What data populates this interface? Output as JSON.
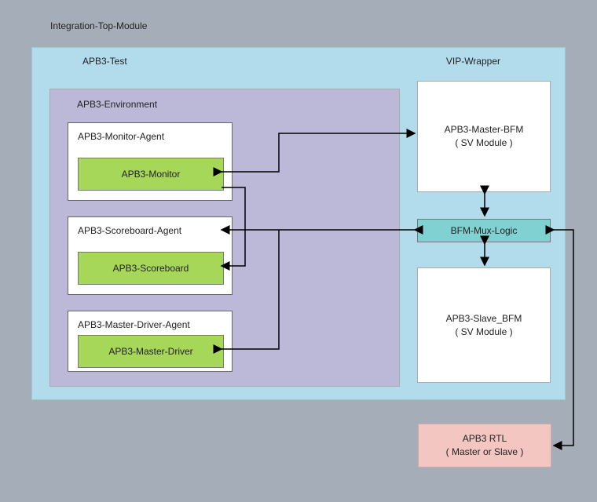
{
  "title": "Integration-Top-Module",
  "test": {
    "label": "APB3-Test",
    "env_label": "APB3-Environment",
    "agents": {
      "monitor": {
        "agent_label": "APB3-Monitor-Agent",
        "inner_label": "APB3-Monitor"
      },
      "scoreboard": {
        "agent_label": "APB3-Scoreboard-Agent",
        "inner_label": "APB3-Scoreboard"
      },
      "driver": {
        "agent_label": "APB3-Master-Driver-Agent",
        "inner_label": "APB3-Master-Driver"
      }
    }
  },
  "vip": {
    "label": "VIP-Wrapper",
    "master_bfm": {
      "line1": "APB3-Master-BFM",
      "line2": "( SV Module )"
    },
    "mux": "BFM-Mux-Logic",
    "slave_bfm": {
      "line1": "APB3-Slave_BFM",
      "line2": "( SV Module )"
    }
  },
  "rtl": {
    "line1": "APB3 RTL",
    "line2": "( Master or Slave )"
  }
}
